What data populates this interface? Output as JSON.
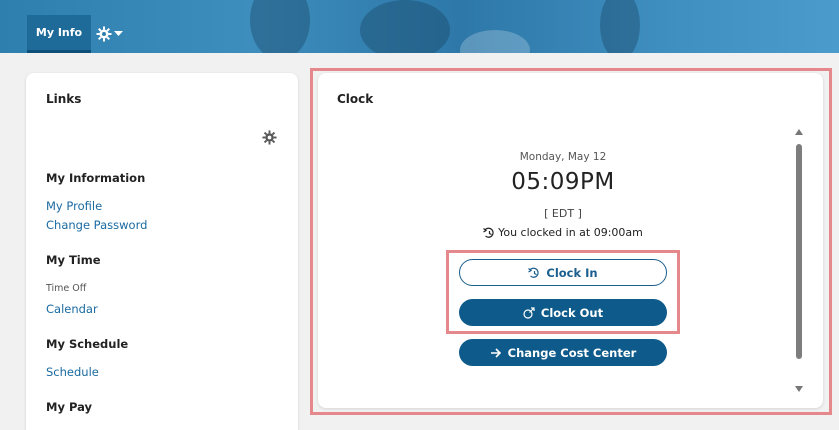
{
  "header": {
    "tab_myinfo": "My Info"
  },
  "links": {
    "title": "Links",
    "sections": [
      {
        "heading": "My Information"
      },
      {
        "heading": "My Time"
      },
      {
        "heading": "My Schedule"
      },
      {
        "heading": "My Pay"
      }
    ],
    "my_profile": "My Profile",
    "change_password": "Change Password",
    "time_off": "Time Off",
    "calendar": "Calendar",
    "schedule": "Schedule"
  },
  "clock": {
    "title": "Clock",
    "date": "Monday, May 12",
    "time": "05:09PM",
    "timezone": "[ EDT ]",
    "status": "You clocked in at 09:00am",
    "clock_in_label": "Clock In",
    "clock_out_label": "Clock Out",
    "change_cost_center_label": "Change Cost Center"
  },
  "colors": {
    "accent": "#0e5a8a",
    "link": "#1a6aa0",
    "highlight": "#e4888c"
  },
  "icons": [
    "gear-icon",
    "chevron-down-icon",
    "clock-in-icon",
    "clock-out-icon",
    "arrow-right-icon",
    "scroll-up-icon",
    "scroll-down-icon"
  ]
}
